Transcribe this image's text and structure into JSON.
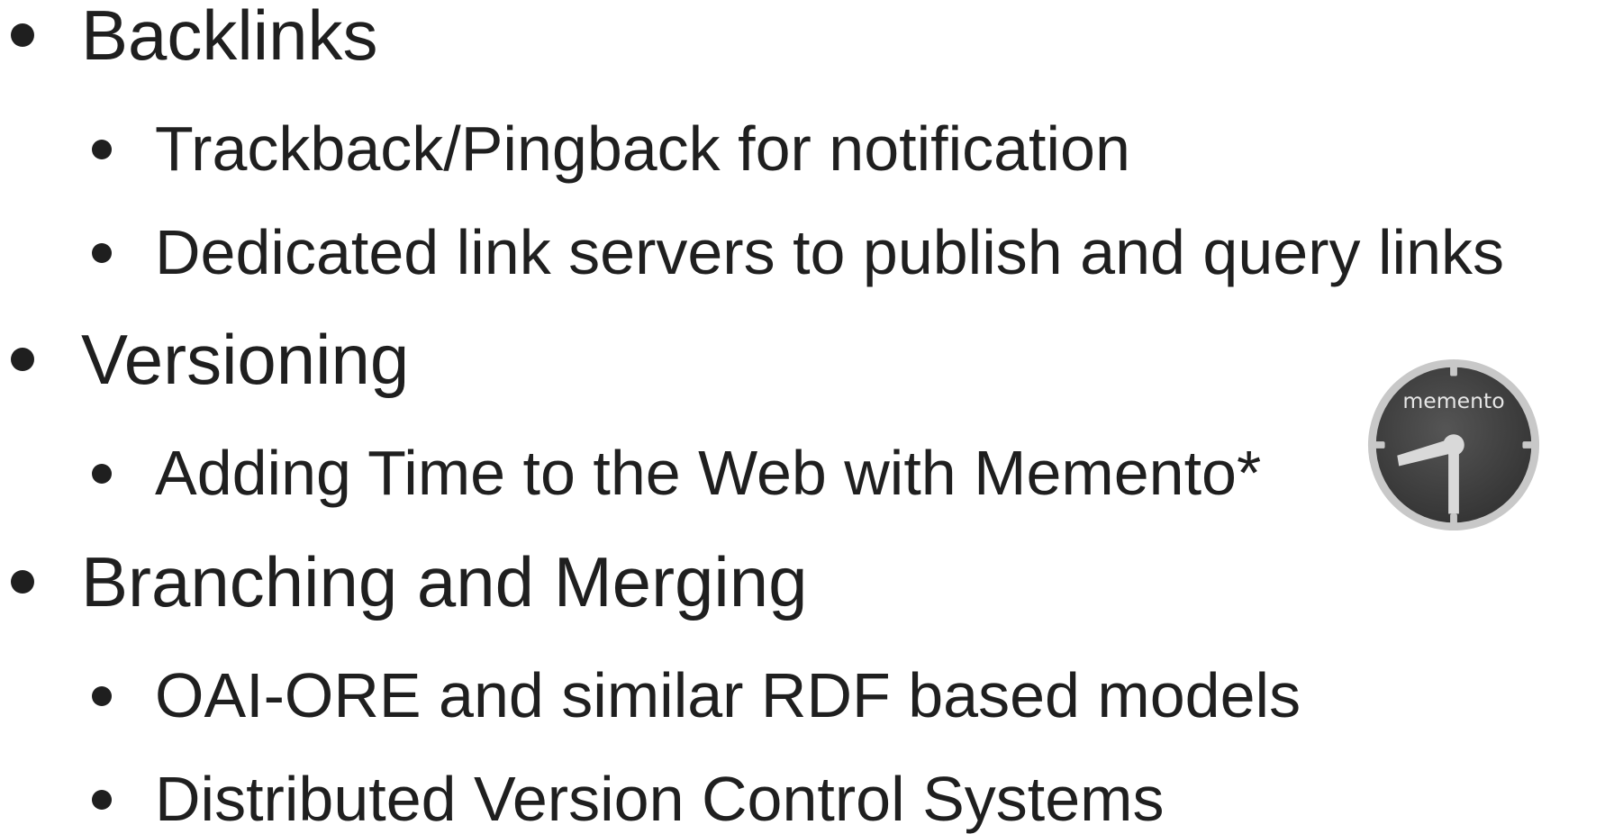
{
  "slide": {
    "items": [
      {
        "level": 1,
        "text": "Backlinks"
      },
      {
        "level": 2,
        "text": "Trackback/Pingback for notification"
      },
      {
        "level": 2,
        "text": "Dedicated link servers to publish and query links"
      },
      {
        "level": 1,
        "text": "Versioning"
      },
      {
        "level": 2,
        "text": "Adding Time to the Web with Memento*"
      },
      {
        "level": 1,
        "text": "Branching and Merging"
      },
      {
        "level": 2,
        "text": "OAI-ORE and similar RDF based models"
      },
      {
        "level": 2,
        "text": "Distributed Version Control Systems"
      }
    ]
  },
  "logo": {
    "name": "memento-clock-logo",
    "text": "memento",
    "face_color": "#3f3f3f",
    "rim_color": "#c8c8c8",
    "hand_color": "#d9d9d9"
  }
}
